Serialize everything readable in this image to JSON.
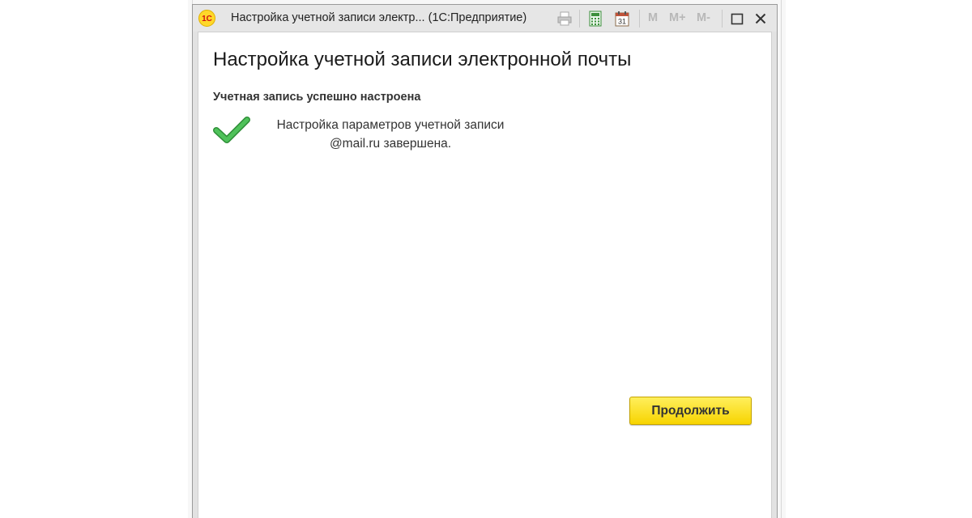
{
  "window": {
    "title": "Настройка учетной записи электр...  (1С:Предприятие)",
    "app_logo_text": "1С",
    "toolbar": {
      "memory_m": "M",
      "memory_plus": "M+",
      "memory_minus": "M-",
      "calendar_day": "31"
    }
  },
  "form": {
    "heading": "Настройка учетной записи электронной почты",
    "status_title": "Учетная запись успешно настроена",
    "message_line1": "Настройка параметров учетной записи",
    "message_line2": "@mail.ru завершена.",
    "continue_label": "Продолжить"
  },
  "colors": {
    "accent_button": "#f7d400",
    "success_check": "#3fae48",
    "logo_bg": "#ffd82a",
    "logo_text": "#d01010"
  }
}
